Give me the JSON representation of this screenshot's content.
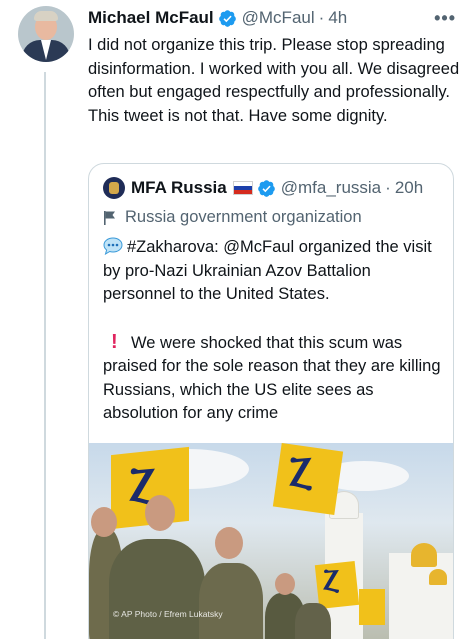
{
  "tweet": {
    "author_name": "Michael McFaul",
    "author_handle": "@McFaul",
    "separator": "·",
    "time": "4h",
    "more_label": "•••",
    "text": "I did not organize this trip. Please stop spreading disinformation. I worked with you all. We disagreed often  but engaged respectfully and professionally. This tweet is not that. Have some dignity."
  },
  "quoted": {
    "author_name": "MFA Russia",
    "author_handle": "@mfa_russia",
    "separator": "·",
    "time": "20h",
    "affiliation": "Russia government organization",
    "para1": "#Zakharova: @McFaul organized the visit by pro-Nazi Ukrainian Azov Battalion personnel to the United States.",
    "excl_mark": "!",
    "para2": "We were shocked that this scum was praised for the sole reason that they are killing Russians, which the US elite sees as absolution for any crime",
    "photo_credit": "© AP Photo / Efrem Lukatsky"
  },
  "colors": {
    "verified_blue": "#1d9bf0",
    "secondary_text": "#536471",
    "border": "#cfd9de",
    "alert_red": "#e0245e"
  },
  "icons": {
    "verified": "verified-badge-icon",
    "more": "more-options-icon",
    "flag": "russia-flag-icon",
    "affiliation": "government-flag-icon",
    "speech": "speech-bubble-icon",
    "exclamation": "exclamation-icon"
  }
}
